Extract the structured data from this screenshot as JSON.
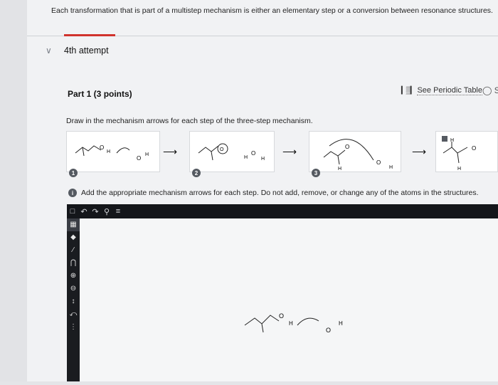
{
  "intro": "Each transformation that is part of a multistep mechanism is either an elementary step or a conversion between resonance structures.",
  "attempt": {
    "label": "4th attempt",
    "expanded": true
  },
  "part": {
    "title": "Part 1  (3 points)"
  },
  "periodic": {
    "label": "See Periodic Table"
  },
  "instruction": "Draw in the mechanism arrows for each step of the three-step mechanism.",
  "steps": [
    {
      "number": "1",
      "atoms": [
        "O",
        "H",
        "O",
        "H"
      ]
    },
    {
      "number": "2",
      "atoms": [
        "O",
        "H",
        "O",
        "H"
      ]
    },
    {
      "number": "3",
      "atoms": [
        "O",
        "H",
        "O",
        "H"
      ]
    }
  ],
  "final_structure": {
    "atoms": [
      "H",
      "O",
      "H"
    ]
  },
  "info": {
    "icon": "i",
    "text": "Add the appropriate mechanism arrows for each step. Do not add, remove, or change any of the atoms in the structures."
  },
  "toolbar": {
    "icons": [
      "new-document-icon",
      "undo-icon",
      "redo-icon",
      "zoom-icon",
      "settings-icon"
    ]
  },
  "side_tools": [
    "select-icon",
    "eraser-icon",
    "bond-icon",
    "atom-label-icon",
    "plus-charge-icon",
    "minus-charge-icon",
    "arrow-icon",
    "curved-arrow-icon",
    "lone-pair-icon"
  ],
  "canvas": {
    "atoms": [
      "O",
      "H",
      "O",
      "H"
    ]
  },
  "colors": {
    "accent": "#d0332d",
    "toolbar": "#14161a"
  }
}
